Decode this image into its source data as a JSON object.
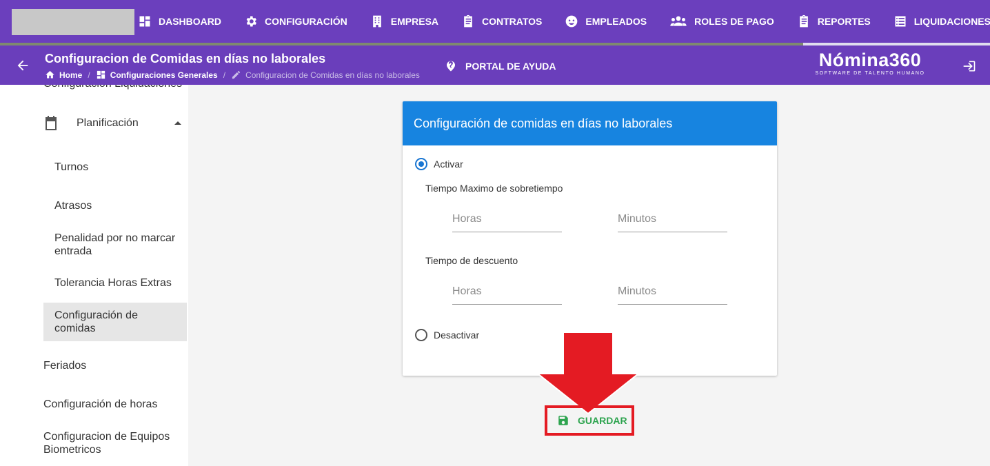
{
  "topnav": {
    "items": [
      {
        "label": "DASHBOARD",
        "icon": "dashboard-icon"
      },
      {
        "label": "CONFIGURACIÓN",
        "icon": "gear-icon"
      },
      {
        "label": "EMPRESA",
        "icon": "building-icon"
      },
      {
        "label": "CONTRATOS",
        "icon": "clipboard-icon"
      },
      {
        "label": "EMPLEADOS",
        "icon": "face-icon"
      },
      {
        "label": "ROLES DE PAGO",
        "icon": "group-icon"
      },
      {
        "label": "REPORTES",
        "icon": "clipboard-icon"
      },
      {
        "label": "LIQUIDACIONES",
        "icon": "list-icon"
      }
    ]
  },
  "header": {
    "title": "Configuracion de Comidas en días no laborales",
    "breadcrumb": {
      "home": "Home",
      "section": "Configuraciones Generales",
      "current": "Configuracion de Comidas en días no laborales"
    },
    "help": "PORTAL DE AYUDA",
    "brand": "Nómina360",
    "brand_tagline": "SOFTWARE DE TALENTO HUMANO"
  },
  "sidebar": {
    "cut_item": "Configuración Liquidaciones",
    "group": "Planificación",
    "sub_items": [
      "Turnos",
      "Atrasos",
      "Penalidad por no marcar entrada",
      "Tolerancia Horas Extras",
      "Configuración de comidas"
    ],
    "items": [
      "Feriados",
      "Configuración de horas",
      "Configuracion de Equipos Biometricos"
    ]
  },
  "card": {
    "title": "Configuración de comidas en días no laborales",
    "activar": "Activar",
    "desactivar": "Desactivar",
    "sobretiempo_label": "Tiempo Maximo de sobretiempo",
    "descuento_label": "Tiempo de descuento",
    "horas_placeholder": "Horas",
    "minutos_placeholder": "Minutos"
  },
  "save_label": "GUARDAR",
  "colors": {
    "nav": "#6b3fbd",
    "card_header": "#1784e0",
    "save": "#2ea44f",
    "annotation": "#e41b23"
  }
}
